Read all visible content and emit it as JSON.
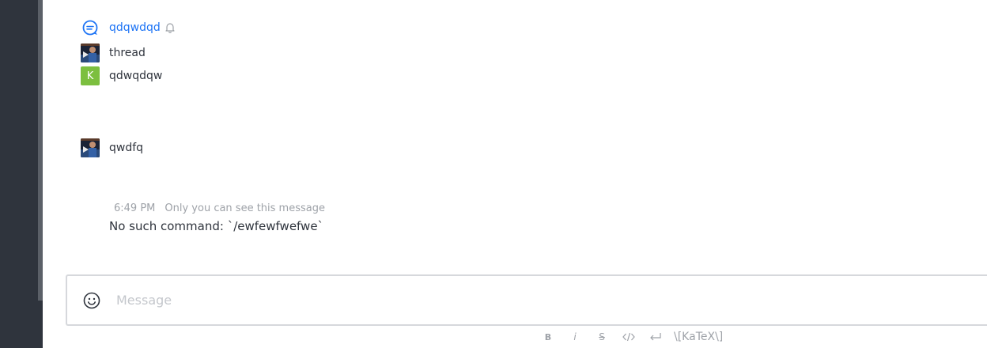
{
  "thread_items": [
    {
      "type": "discussion",
      "label": "qdqwdqd",
      "icon": "discussion-icon",
      "has_bell": true
    },
    {
      "type": "user",
      "label": "thread",
      "avatar": "photo"
    },
    {
      "type": "user",
      "label": "qdwqdqw",
      "avatar": "letter",
      "avatar_letter": "K",
      "avatar_color": "#7cbf3f"
    }
  ],
  "message": {
    "label": "qwdfq",
    "avatar": "photo"
  },
  "system_message": {
    "time": "6:49 PM",
    "ephemeral_note": "Only you can see this message",
    "body": "No such command: `/ewfewfwefwe`"
  },
  "composer": {
    "placeholder": "Message",
    "value": ""
  },
  "formatting": {
    "bold": "B",
    "italic": "i",
    "strike": "S",
    "katex": "\\[KaTeX\\]"
  },
  "colors": {
    "sidebar": "#2f343d",
    "link": "#1d74f5",
    "avatar_letter_bg": "#7cbf3f",
    "muted_text": "#9ea2a8"
  }
}
